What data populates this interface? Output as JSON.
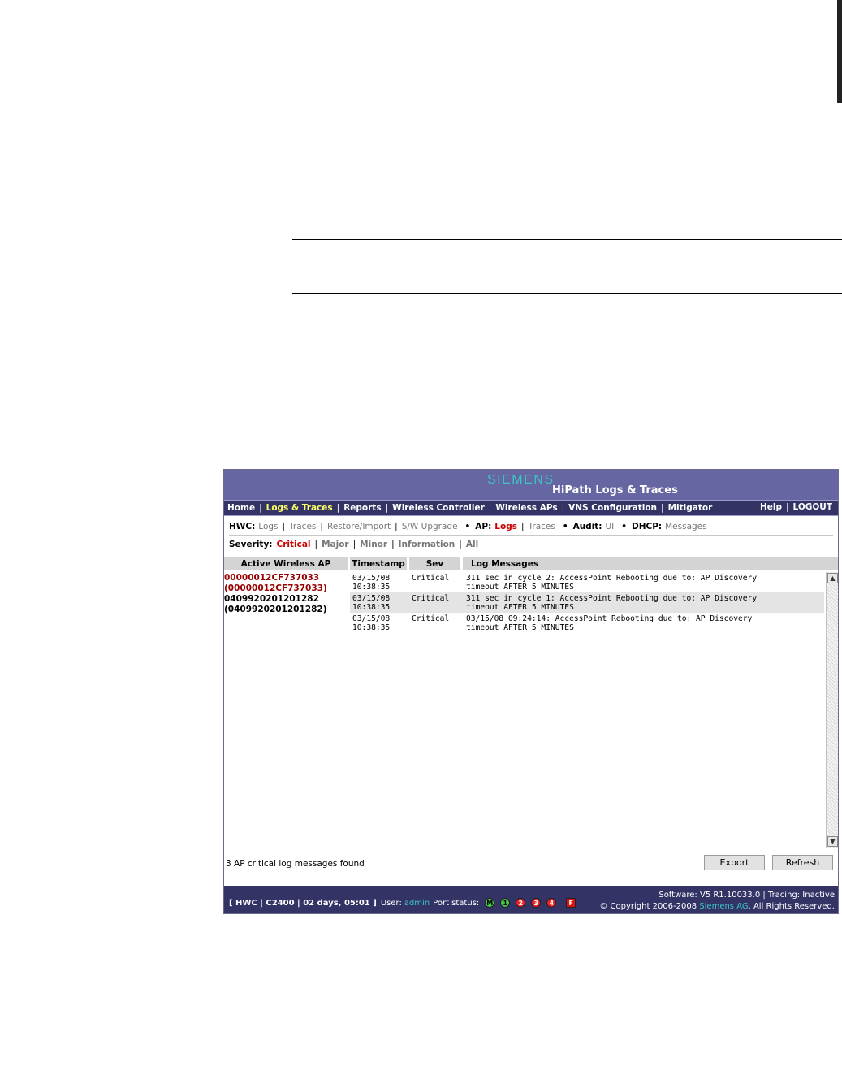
{
  "app": {
    "brand": "SIEMENS",
    "title": "HiPath Logs & Traces"
  },
  "topnav": {
    "items": [
      "Home",
      "Logs & Traces",
      "Reports",
      "Wireless Controller",
      "Wireless APs",
      "VNS Configuration",
      "Mitigator"
    ],
    "active_index": 1,
    "help": "Help",
    "logout": "LOGOUT"
  },
  "subnav": {
    "hwc_label": "HWC:",
    "hwc_links": [
      "Logs",
      "Traces",
      "Restore/Import",
      "S/W Upgrade"
    ],
    "ap_label": "AP:",
    "ap_links": [
      "Logs",
      "Traces"
    ],
    "ap_selected": "Logs",
    "audit_label": "Audit:",
    "audit_links": [
      "UI"
    ],
    "dhcp_label": "DHCP:",
    "dhcp_links": [
      "Messages"
    ]
  },
  "severity": {
    "label": "Severity:",
    "options": [
      "Critical",
      "Major",
      "Minor",
      "Information",
      "All"
    ],
    "selected": "Critical"
  },
  "table": {
    "columns": [
      "Active Wireless AP",
      "Timestamp",
      "Sev",
      "Log Messages"
    ]
  },
  "aps": [
    {
      "line1": "00000012CF737033",
      "line2": "(00000012CF737033)",
      "selected": true
    },
    {
      "line1": "0409920201201282",
      "line2": "(0409920201201282)",
      "selected": false
    }
  ],
  "logs": [
    {
      "date": "03/15/08",
      "time": "10:38:35",
      "sev": "Critical",
      "msg1": "311 sec in cycle 2: AccessPoint Rebooting due to: AP Discovery",
      "msg2": "timeout AFTER 5 MINUTES"
    },
    {
      "date": "03/15/08",
      "time": "10:38:35",
      "sev": "Critical",
      "msg1": "311 sec in cycle 1: AccessPoint Rebooting due to: AP Discovery",
      "msg2": "timeout AFTER 5 MINUTES"
    },
    {
      "date": "03/15/08",
      "time": "10:38:35",
      "sev": "Critical",
      "msg1": "03/15/08 09:24:14: AccessPoint Rebooting due to: AP Discovery",
      "msg2": "timeout AFTER 5 MINUTES"
    }
  ],
  "status": {
    "found": "3 AP critical log messages found",
    "export": "Export",
    "refresh": "Refresh"
  },
  "footer": {
    "session": "[ HWC | C2400 | 02 days, 05:01 ]",
    "user_label": "User:",
    "user": "admin",
    "port_label": "Port status:",
    "ports": [
      {
        "label": "M",
        "state": "green"
      },
      {
        "label": "1",
        "state": "green"
      },
      {
        "label": "2",
        "state": "red"
      },
      {
        "label": "3",
        "state": "red"
      },
      {
        "label": "4",
        "state": "red"
      },
      {
        "label": "F",
        "state": "red-square"
      }
    ],
    "software": "Software: V5 R1.10033.0 | Tracing: Inactive",
    "copyright_pre": "© Copyright  2006-2008",
    "company": "Siemens AG",
    "copyright_post": ". All Rights Reserved."
  },
  "colors": {
    "banner": "#6666a3",
    "nav": "#333366",
    "brand": "#39c7c2",
    "selected": "#cc0000"
  }
}
